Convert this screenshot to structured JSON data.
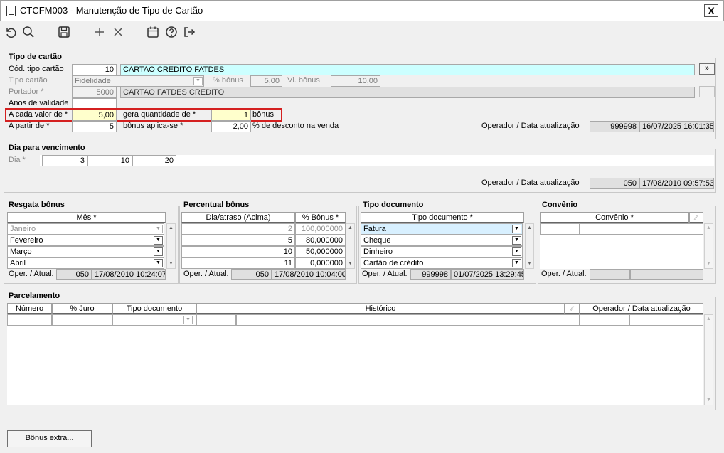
{
  "window": {
    "title": "CTCFM003 - Manutenção de Tipo de Cartão",
    "close_label": "X"
  },
  "toolbar": {
    "icons": [
      "undo-icon",
      "search-icon",
      "save-icon",
      "add-icon",
      "delete-icon",
      "calendar-icon",
      "help-icon",
      "exit-icon"
    ]
  },
  "tipo_cartao": {
    "section_title": "Tipo de cartão",
    "cod_label": "Cód. tipo cartão",
    "cod_value": "10",
    "desc_value": "CARTAO CREDITO FATDES",
    "lookup_button": "»",
    "tipo_label": "Tipo cartão",
    "tipo_value": "Fidelidade",
    "pct_bonus_label": "% bônus",
    "pct_bonus_value": "5,00",
    "vl_bonus_label": "Vl. bônus",
    "vl_bonus_value": "10,00",
    "portador_label": "Portador *",
    "portador_code": "5000",
    "portador_name": "CARTAO FATDES CREDITO",
    "anos_label": "Anos de validade",
    "anos_value": "",
    "a_cada_label": "A cada valor de *",
    "a_cada_value": "5,00",
    "gera_label": "gera quantidade de *",
    "gera_value": "1",
    "bonus_unit": "bônus",
    "a_partir_label": "A partir de *",
    "a_partir_value": "5",
    "aplica_label": "bônus aplica-se *",
    "aplica_value": "2,00",
    "desconto_label": "% de desconto na venda",
    "oper_label": "Operador / Data atualização",
    "oper_code": "999998",
    "oper_date": "16/07/2025 16:01:35"
  },
  "vencimento": {
    "section_title": "Dia para vencimento",
    "dia_label": "Dia *",
    "dias": [
      "3",
      "10",
      "20"
    ],
    "oper_label": "Operador / Data atualização",
    "oper_code": "050",
    "oper_date": "17/08/2010 09:57:53"
  },
  "resgata": {
    "section_title": "Resgata bônus",
    "col_header": "Mês *",
    "rows": [
      "Janeiro",
      "Fevereiro",
      "Março",
      "Abril"
    ],
    "oper_label": "Oper. / Atual.",
    "oper_code": "050",
    "oper_date": "17/08/2010 10:24:07"
  },
  "percentual": {
    "section_title": "Percentual bônus",
    "col1_header": "Dia/atraso (Acima)",
    "col2_header": "% Bônus *",
    "rows": [
      {
        "dia": "2",
        "pct": "100,000000"
      },
      {
        "dia": "5",
        "pct": "80,000000"
      },
      {
        "dia": "10",
        "pct": "50,000000"
      },
      {
        "dia": "11",
        "pct": "0,000000"
      }
    ],
    "oper_label": "Oper. / Atual.",
    "oper_code": "050",
    "oper_date": "17/08/2010 10:04:00"
  },
  "tipo_documento": {
    "section_title": "Tipo documento",
    "col_header": "Tipo documento *",
    "rows": [
      "Fatura",
      "Cheque",
      "Dinheiro",
      "Cartão de crédito"
    ],
    "oper_label": "Oper. / Atual.",
    "oper_code": "999998",
    "oper_date": "01/07/2025 13:29:45"
  },
  "convenio": {
    "section_title": "Convênio",
    "col_header": "Convênio *",
    "oper_label": "Oper. / Atual."
  },
  "parcelamento": {
    "section_title": "Parcelamento",
    "headers": [
      "Número",
      "% Juro",
      "Tipo documento",
      "Histórico",
      "Operador / Data atualização"
    ]
  },
  "bonus_extra_button": "Bônus extra..."
}
